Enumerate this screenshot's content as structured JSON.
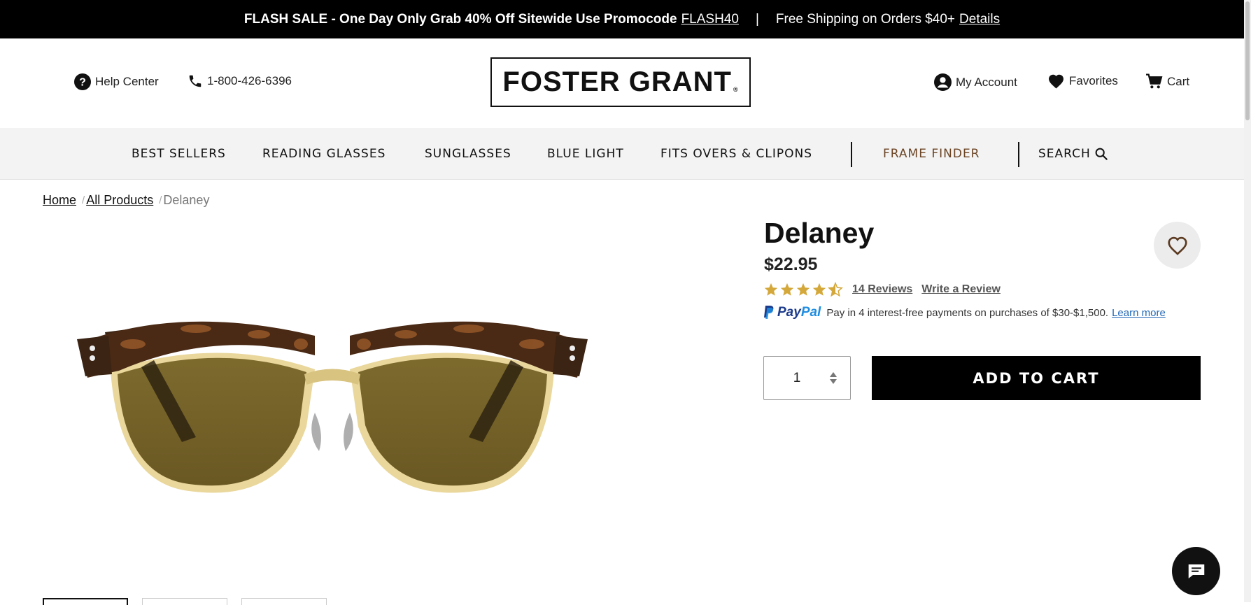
{
  "promo": {
    "text": "FLASH SALE - One Day Only Grab 40% Off Sitewide Use Promocode",
    "code": "FLASH40",
    "separator": "|",
    "shipping": "Free Shipping on Orders $40+",
    "details": "Details"
  },
  "header": {
    "help": "Help Center",
    "phone": "1-800-426-6396",
    "logo": "FOSTER GRANT",
    "logo_mark": "®",
    "account": "My Account",
    "favorites": "Favorites",
    "cart": "Cart"
  },
  "nav": {
    "best_sellers": "BEST SELLERS",
    "reading_glasses": "READING GLASSES",
    "sunglasses": "SUNGLASSES",
    "blue_light": "BLUE LIGHT",
    "fits_overs": "FITS OVERS & CLIPONS",
    "frame_finder": "FRAME FINDER",
    "search": "SEARCH"
  },
  "breadcrumb": {
    "home": "Home",
    "all_products": "All Products",
    "current": "Delaney",
    "slash": "/"
  },
  "product": {
    "name": "Delaney",
    "price": "$22.95",
    "rating": 4.5,
    "reviews": "14 Reviews",
    "write_review": "Write a Review",
    "quantity": "1",
    "add_to_cart": "ADD TO CART"
  },
  "paypal": {
    "brand_pay": "Pay",
    "brand_pal": "Pal",
    "text": "Pay in 4 interest-free payments on purchases of $30-$1,500.",
    "learn_more": "Learn more"
  },
  "colors": {
    "frame_finder": "#6b4424",
    "stars": "#d4a83a",
    "paypal_dark": "#1d3b8b",
    "paypal_light": "#1f8de1"
  }
}
